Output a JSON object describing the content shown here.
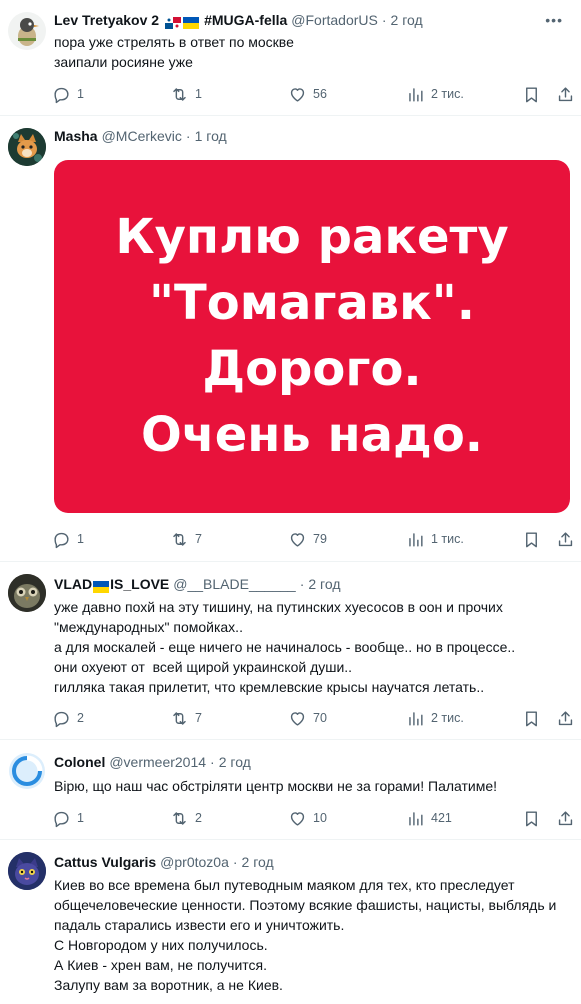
{
  "colors": {
    "accent": "#1d9bf0",
    "text": "#0f1419",
    "secondary": "#536471",
    "media_bg": "#e8123b"
  },
  "tweets": [
    {
      "name": "Lev Tretyakov 2",
      "name_suffix": "#MUGA-fella",
      "handle": "@FortadorUS",
      "sep": "·",
      "time": "2 год",
      "text": "пора уже стрелять в ответ по москве\nзаипали росияне уже",
      "replies": "1",
      "retweets": "1",
      "likes": "56",
      "views": "2 тис.",
      "avatar_icon": "bird-icon"
    },
    {
      "name": "Masha",
      "handle": "@MCerkevic",
      "sep": "·",
      "time": "1 год",
      "media_lines": [
        "Куплю ракету",
        "\"Томагавк\".",
        "Дорого.",
        "Очень надо."
      ],
      "replies": "1",
      "retweets": "7",
      "likes": "79",
      "views": "1 тис.",
      "avatar_icon": "cat-icon"
    },
    {
      "name": "VLAD",
      "name_suffix": "IS_LOVE",
      "handle": "@__BLADE______",
      "sep": "·",
      "time": "2 год",
      "text": "уже давно похй на эту тишину, на путинских хуесосов в оон и прочих \"международных\" помойках..\nа для москалей - еще ничего не начиналось - вообще.. но в процессе..\nони охуеют от  всей щирой украинской души..\nгилляка такая прилетит, что кремлевские крысы научатся летать..",
      "replies": "2",
      "retweets": "7",
      "likes": "70",
      "views": "2 тис.",
      "avatar_icon": "owl-icon"
    },
    {
      "name": "Colonel",
      "handle": "@vermeer2014",
      "sep": "·",
      "time": "2 год",
      "text": "Вірю, що наш час обстріляти центр москви не за горами! Палатиме!",
      "replies": "1",
      "retweets": "2",
      "likes": "10",
      "views": "421",
      "avatar_icon": "ring-icon"
    },
    {
      "name": "Cattus Vulgaris",
      "handle": "@pr0toz0a",
      "sep": "·",
      "time": "2 год",
      "text": "Киев во все времена был путеводным маяком для тех, кто преследует общечеловеческие ценности. Поэтому всякие фашисты, нацисты, выблядь и падаль старались извести его и уничтожить.\nС Новгородом у них получилось.\nА Киев - хрен вам, не получится.\nЗалупу вам за воротник, а не Киев.",
      "avatar_icon": "cat-face-icon"
    }
  ]
}
